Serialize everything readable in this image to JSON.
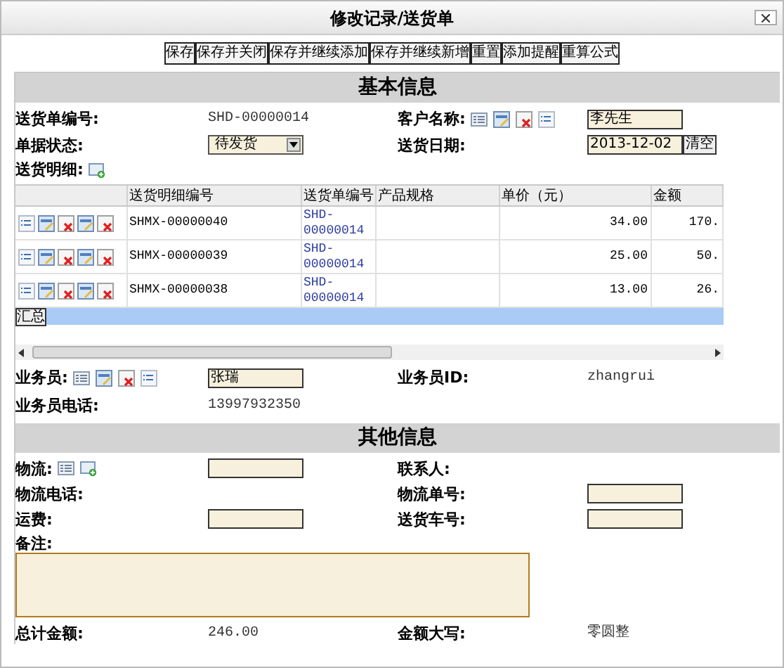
{
  "window": {
    "title": "修改记录/送货单"
  },
  "toolbar": [
    "保存",
    "保存并关闭",
    "保存并继续添加",
    "保存并继续新增",
    "重置",
    "添加提醒",
    "重算公式"
  ],
  "sections": [
    {
      "title": "基本信息",
      "rows": [
        [
          {
            "label": "送货单编号:",
            "kind": "text",
            "value": "SHD-00000014"
          },
          {
            "label": "客户名称:",
            "kind": "lookup",
            "value": "李先生"
          }
        ],
        [
          {
            "label": "单据状态:",
            "kind": "select",
            "value": "待发货"
          },
          {
            "label": "送货日期:",
            "kind": "date",
            "value": "2013-12-02",
            "button": "清空"
          }
        ],
        [
          {
            "label": "送货明细:",
            "kind": "add-label"
          }
        ]
      ],
      "table": {
        "columns": [
          "",
          "送货明细编号",
          "送货单编号",
          "产品规格",
          "单价（元）",
          "金额"
        ],
        "rows": [
          {
            "cells": [
              "",
              "SHMX-00000040",
              "SHD-00000014",
              "",
              "34.00",
              "170."
            ]
          },
          {
            "cells": [
              "",
              "SHMX-00000039",
              "SHD-00000014",
              "",
              "25.00",
              "50."
            ]
          },
          {
            "cells": [
              "",
              "SHMX-00000038",
              "SHD-00000014",
              "",
              "13.00",
              "26."
            ]
          }
        ],
        "summary": "汇总"
      },
      "after": [
        [
          {
            "label": "业务员:",
            "kind": "lookup",
            "value": "张瑞"
          },
          {
            "label": "业务员ID:",
            "kind": "text",
            "value": "zhangrui"
          }
        ],
        [
          {
            "label": "业务员电话:",
            "kind": "text",
            "value": "13997932350"
          }
        ]
      ]
    },
    {
      "title": "其他信息",
      "rows": [
        [
          {
            "label": "物流:",
            "kind": "lookup-add"
          },
          {
            "label": "联系人:",
            "kind": "label"
          }
        ],
        [
          {
            "label": "物流电话:",
            "kind": "label"
          },
          {
            "label": "物流单号:",
            "kind": "input"
          }
        ],
        [
          {
            "label": "运费:",
            "kind": "input"
          },
          {
            "label": "送货车号:",
            "kind": "input"
          }
        ],
        [
          {
            "label": "备注:",
            "kind": "textarea"
          }
        ],
        [
          {
            "label": "总计金额:",
            "kind": "text",
            "value": "246.00"
          },
          {
            "label": "金额大写:",
            "kind": "text",
            "value": "零圆整"
          }
        ]
      ]
    }
  ]
}
